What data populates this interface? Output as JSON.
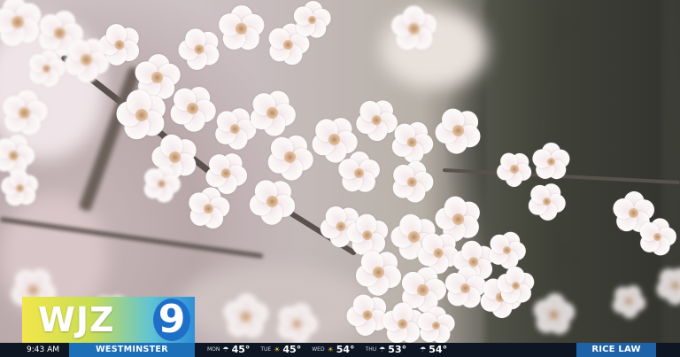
{
  "station": {
    "call_letters": "WJZ",
    "channel": "9"
  },
  "ticker": {
    "time": "9:43 AM",
    "location": "WESTMINSTER",
    "forecast": [
      {
        "day": "MON",
        "icon": "cloud-rain-icon",
        "temp": "45°"
      },
      {
        "day": "TUE",
        "icon": "sun-icon",
        "temp": "45°"
      },
      {
        "day": "WED",
        "icon": "sun-icon",
        "temp": "54°"
      },
      {
        "day": "THU",
        "icon": "cloud-rain-icon",
        "temp": "53°"
      },
      {
        "day": "",
        "icon": "cloud-rain-icon",
        "temp": "54°"
      }
    ],
    "segment": "RICE LAW"
  },
  "colors": {
    "ticker_bg": "#0e1624",
    "location_bg": "#1d6fb8",
    "segment_bg": "#1e63a8",
    "logo_blue": "#1f6fc8",
    "logo_yellow": "#f2e64b"
  }
}
